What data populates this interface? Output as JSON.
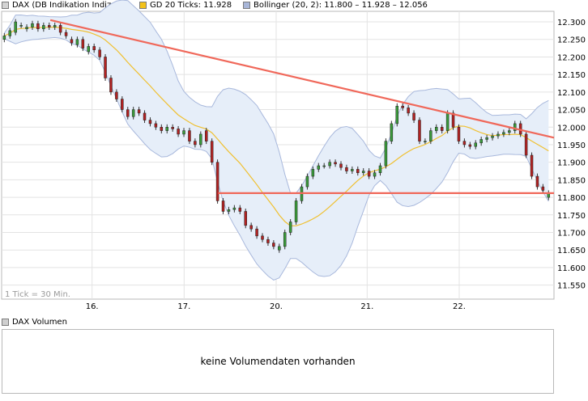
{
  "legend": {
    "item1": "DAX (DB Indikation Indizes)",
    "item2": "GD 20 Ticks: 11.928",
    "item3": "Bollinger (20, 2): 11.800 – 11.928 – 12.056",
    "item1_color": "#d3d3d3",
    "item2_color": "#f3c21a",
    "item3_color": "#a8b6d8"
  },
  "tick_note": "1 Tick = 30 Min.",
  "volume": {
    "label": "DAX Volumen",
    "message": "keine Volumendaten vorhanden",
    "swatch_color": "#cfcfcf"
  },
  "colors": {
    "up_candle": "#3a9a3a",
    "down_candle": "#b22222",
    "sma": "#f0c030",
    "band_fill": "#e6eef9",
    "band_line": "#a8b8dc",
    "trendline": "#f0685a"
  },
  "chart_data": {
    "type": "candlestick",
    "ylim": [
      11510,
      12330
    ],
    "yticks": [
      11550,
      11600,
      11650,
      11700,
      11750,
      11800,
      11850,
      11900,
      11950,
      12000,
      12050,
      12100,
      12150,
      12200,
      12250,
      12300
    ],
    "ytick_labels": [
      "11.550",
      "11.600",
      "11.650",
      "11.700",
      "11.750",
      "11.800",
      "11.850",
      "11.900",
      "11.950",
      "12.000",
      "12.050",
      "12.100",
      "12.150",
      "12.200",
      "12.250",
      "12.300"
    ],
    "xlim": [
      0,
      102
    ],
    "xticks": [
      {
        "x": 16.7,
        "label": "16."
      },
      {
        "x": 33.7,
        "label": "17."
      },
      {
        "x": 50.7,
        "label": "20."
      },
      {
        "x": 67.5,
        "label": "21."
      },
      {
        "x": 84.5,
        "label": "22."
      }
    ],
    "day_separators": [
      16.7,
      33.7,
      50.7,
      67.5,
      84.5
    ],
    "grid": true,
    "close": [
      12260,
      12275,
      12300,
      12290,
      12285,
      12295,
      12280,
      12290,
      12285,
      12290,
      12270,
      12260,
      12240,
      12250,
      12225,
      12230,
      12220,
      12200,
      12140,
      12100,
      12080,
      12050,
      12030,
      12050,
      12040,
      12020,
      12010,
      12000,
      11990,
      12000,
      11995,
      11980,
      11990,
      11960,
      11950,
      11980,
      11960,
      11900,
      11790,
      11760,
      11765,
      11770,
      11760,
      11720,
      11710,
      11690,
      11680,
      11670,
      11660,
      11660,
      11700,
      11730,
      11790,
      11830,
      11860,
      11880,
      11890,
      11890,
      11900,
      11895,
      11885,
      11875,
      11880,
      11870,
      11875,
      11860,
      11870,
      11890,
      11960,
      12010,
      12060,
      12055,
      12040,
      12020,
      11960,
      11960,
      11990,
      12000,
      11990,
      12040,
      12000,
      11960,
      11950,
      11945,
      11955,
      11965,
      11970,
      11975,
      11980,
      11985,
      11990,
      12010,
      11980,
      11920,
      11860,
      11830,
      11820,
      11812
    ],
    "open": [
      12250,
      12260,
      12270,
      12290,
      12280,
      12285,
      12295,
      12280,
      12290,
      12285,
      12290,
      12270,
      12250,
      12235,
      12250,
      12215,
      12230,
      12220,
      12200,
      12140,
      12100,
      12080,
      12050,
      12030,
      12050,
      12040,
      12020,
      12010,
      12000,
      11990,
      12000,
      11995,
      11980,
      11990,
      11960,
      11950,
      11990,
      11960,
      11900,
      11790,
      11760,
      11765,
      11770,
      11760,
      11720,
      11710,
      11690,
      11680,
      11670,
      11650,
      11660,
      11700,
      11730,
      11790,
      11830,
      11860,
      11880,
      11890,
      11890,
      11900,
      11895,
      11885,
      11875,
      11880,
      11870,
      11875,
      11860,
      11870,
      11890,
      11960,
      12010,
      12060,
      12055,
      12040,
      12020,
      11960,
      11960,
      11990,
      12000,
      11990,
      12040,
      12000,
      11960,
      11950,
      11945,
      11955,
      11965,
      11970,
      11975,
      11980,
      11985,
      11990,
      12010,
      11980,
      11920,
      11860,
      11830,
      11800
    ],
    "trendline": {
      "from": [
        9,
        12305
      ],
      "to": [
        102,
        11970
      ]
    },
    "support": {
      "from": [
        40,
        11812
      ],
      "to": [
        102,
        11812
      ]
    }
  }
}
